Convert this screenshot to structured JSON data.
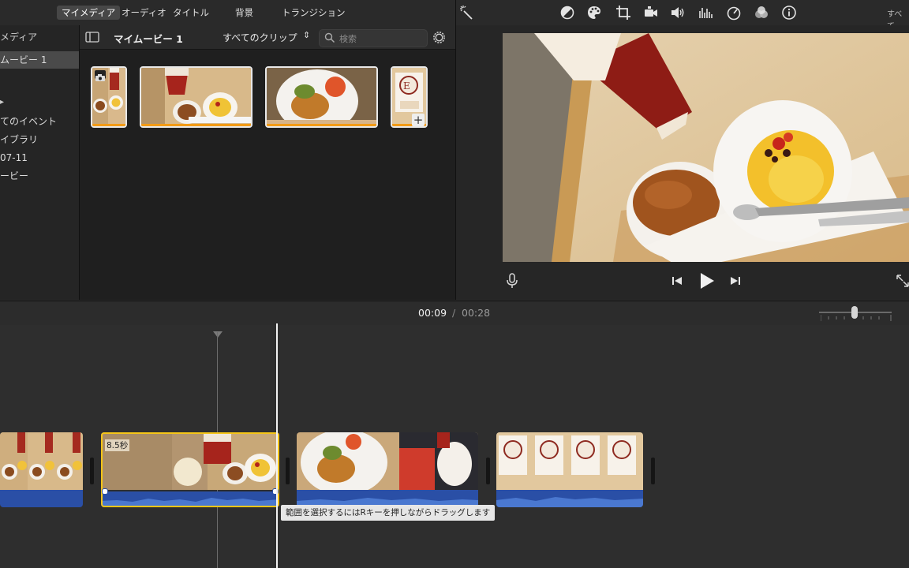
{
  "tabs": {
    "my_media": "マイメディア",
    "audio": "オーディオ",
    "titles": "タイトル",
    "backgrounds": "背景",
    "transitions": "トランジション"
  },
  "viewer_toolbar": {
    "icons": [
      "magic-wand-icon",
      "color-balance-icon",
      "color-palette-icon",
      "crop-icon",
      "stabilization-icon",
      "volume-icon",
      "equalizer-icon",
      "speed-icon",
      "clip-filter-icon",
      "info-icon"
    ],
    "right_text": "すべて"
  },
  "sidebar": {
    "header": "メディア",
    "items": [
      {
        "label": "ムービー 1",
        "selected": true
      },
      {
        "label": "てのイベント"
      },
      {
        "label": "イブラリ"
      },
      {
        "label": "07-11"
      },
      {
        "label": "ービー"
      }
    ]
  },
  "browser": {
    "title": "マイムービー 1",
    "filter": "すべてのクリップ",
    "search_placeholder": "検索"
  },
  "timeline": {
    "current_time": "00:09",
    "separator": "/",
    "total_time": "00:28",
    "selected_clip_duration": "8.5秒",
    "tooltip": "範囲を選択するにはRキーを押しながらドラッグします"
  },
  "colors": {
    "accent": "#f39b16",
    "selection": "#f5c518",
    "audio": "#2a4fa6"
  }
}
